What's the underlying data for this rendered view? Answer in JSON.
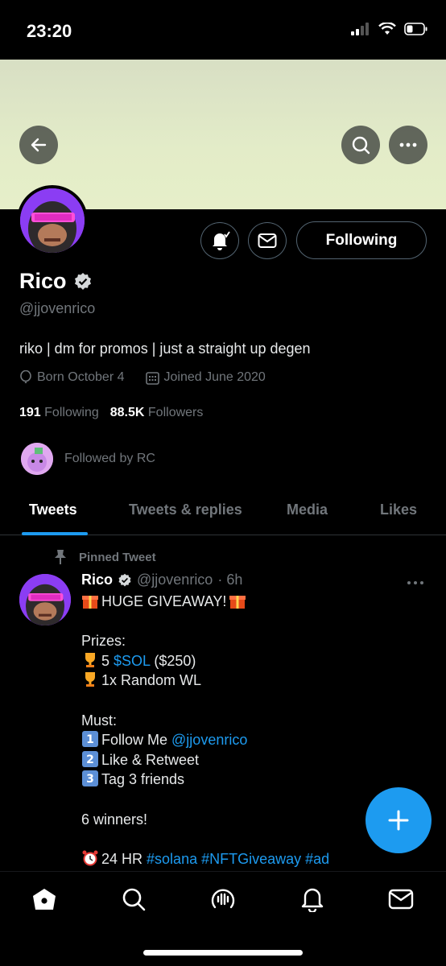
{
  "status_bar": {
    "time": "23:20"
  },
  "profile": {
    "name": "Rico",
    "handle": "@jjovenrico",
    "bio": "riko | dm for promos | just a straight up degen",
    "born": "Born October 4",
    "joined": "Joined June 2020",
    "following_count": "191",
    "following_label": "Following",
    "followers_count": "88.5K",
    "followers_label": "Followers",
    "followed_by": "Followed by RC",
    "follow_button": "Following"
  },
  "tabs": [
    "Tweets",
    "Tweets & replies",
    "Media",
    "Likes"
  ],
  "tweet": {
    "pinned_label": "Pinned Tweet",
    "author": "Rico",
    "handle": "@jjovenrico",
    "time": "· 6h",
    "lines": {
      "l1": "HUGE GIVEAWAY!",
      "l2": "Prizes:",
      "l3a": "5 ",
      "l3b": "$SOL",
      "l3c": " ($250)",
      "l4": "1x Random WL",
      "l5": "Must:",
      "l6a": "Follow Me ",
      "l6b": "@jjovenrico",
      "l7": "Like & Retweet",
      "l8": "Tag 3 friends",
      "l9": "6 winners!",
      "l10a": "24 HR ",
      "l10b": "#solana",
      "l10c": "#NFTGiveaway",
      "l10d": "#ad"
    }
  },
  "colors": {
    "accent": "#1d9bf0",
    "background": "#000000",
    "muted": "#71767b",
    "banner": "#e3ecc8"
  },
  "icons": [
    "back-arrow-icon",
    "search-icon",
    "more-icon",
    "notification-bell-icon",
    "mail-icon",
    "verified-badge-icon",
    "balloon-icon",
    "calendar-icon",
    "pin-icon",
    "gift-icon",
    "trophy-icon",
    "keycap-icon",
    "alarm-clock-icon",
    "compose-plus-icon",
    "home-icon",
    "spaces-icon",
    "bell-icon"
  ]
}
